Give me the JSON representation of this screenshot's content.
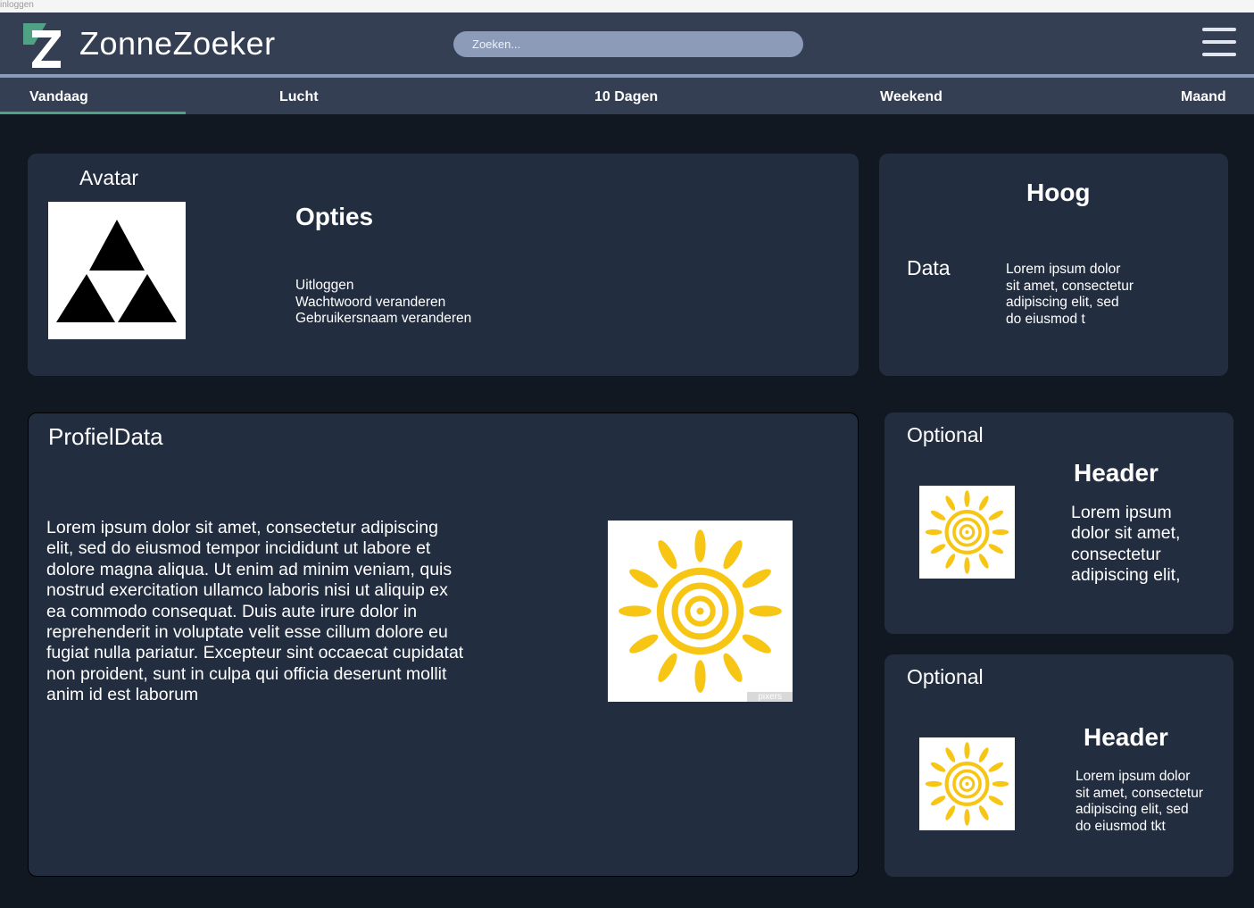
{
  "window": {
    "title": "inloggen"
  },
  "header": {
    "app_title": "ZonneZoeker",
    "search_placeholder": "Zoeken...",
    "colors": {
      "background": "#343f54",
      "accent": "#4fa384",
      "search": "#8c9bb8"
    }
  },
  "tabs": [
    {
      "label": "Vandaag",
      "active": true
    },
    {
      "label": "Lucht"
    },
    {
      "label": "10 Dagen"
    },
    {
      "label": "Weekend"
    },
    {
      "label": "Maand"
    }
  ],
  "avatar_card": {
    "title": "Avatar",
    "image_icon": "triforce-icon",
    "options_header": "Opties",
    "options": [
      "Uitloggen",
      "Wachtwoord veranderen",
      "Gebruikersnaam veranderen"
    ]
  },
  "hoog_card": {
    "header": "Hoog",
    "label": "Data",
    "lines": [
      "Lorem ipsum dolor",
      "sit amet, consectetur",
      "adipiscing elit, sed",
      "do eiusmod t"
    ]
  },
  "profiel_card": {
    "title": "ProfielData",
    "lines": [
      "Lorem ipsum dolor sit amet, consectetur adipiscing",
      "elit, sed do eiusmod tempor incididunt ut labore et",
      "dolore magna aliqua. Ut enim ad minim veniam, quis",
      "nostrud exercitation ullamco laboris nisi ut aliquip ex",
      "ea commodo consequat. Duis aute irure dolor in",
      "reprehenderit in voluptate velit esse cillum dolore eu",
      "fugiat nulla pariatur. Excepteur sint occaecat cupidatat",
      "non proident, sunt in culpa qui officia deserunt mollit",
      "anim id est laborum"
    ],
    "image_icon": "sun-icon",
    "watermark": "pixers"
  },
  "optional_cards": [
    {
      "title": "Optional",
      "header": "Header",
      "lines": [
        "Lorem ipsum",
        "dolor sit amet,",
        "consectetur",
        "adipiscing elit,"
      ]
    },
    {
      "title": "Optional",
      "header": "Header",
      "lines": [
        "Lorem ipsum dolor",
        "sit amet, consectetur",
        "adipiscing elit, sed",
        "do eiusmod tkt"
      ]
    }
  ]
}
